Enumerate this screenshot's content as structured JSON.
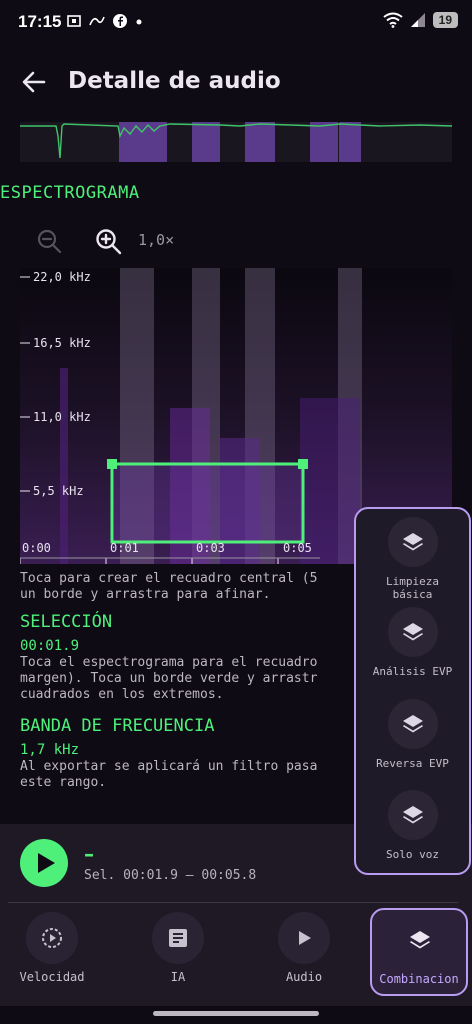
{
  "status_bar": {
    "time": "17:15",
    "battery": "19"
  },
  "app_bar": {
    "title": "Detalle de audio"
  },
  "spectrogram": {
    "label": "ESPECTROGRAMA",
    "zoom_level": "1,0×",
    "freq_ticks": [
      "22,0 kHz",
      "16,5 kHz",
      "11,0 kHz",
      "5,5 kHz"
    ],
    "time_ticks": [
      "0:00",
      "0:01",
      "0:03",
      "0:05"
    ],
    "hint_line1": "Toca para crear el recuadro central (5",
    "hint_line2": "un borde y arrastra para afinar."
  },
  "selection": {
    "label": "SELECCIÓN",
    "value": "00:01.9",
    "help_line1": "Toca el espectrograma para el recuadro",
    "help_line2": "margen). Toca un borde verde y arrastr",
    "help_line3": "cuadrados en los extremos."
  },
  "band": {
    "label": "BANDA DE FRECUENCIA",
    "value": "1,7 kHz",
    "help_line1": "Al exportar se aplicará un filtro pasa",
    "help_line2": "este rango."
  },
  "player": {
    "title": "–",
    "range": "Sel. 00:01.9 – 00:05.8"
  },
  "bottom_nav": {
    "items": [
      {
        "label": "Velocidad",
        "icon": "speed-icon"
      },
      {
        "label": "IA",
        "icon": "document-icon"
      },
      {
        "label": "Audio",
        "icon": "play-icon"
      },
      {
        "label": "Combinacion",
        "icon": "layers-icon"
      }
    ]
  },
  "combinations_menu": {
    "items": [
      {
        "label_line1": "Limpieza",
        "label_line2": "básica"
      },
      {
        "label_line1": "Análisis EVP",
        "label_line2": ""
      },
      {
        "label_line1": "Reversa EVP",
        "label_line2": ""
      },
      {
        "label_line1": "Solo voz",
        "label_line2": ""
      }
    ]
  },
  "colors": {
    "accent_green": "#4ef07a",
    "accent_purple": "#b79cf0",
    "background": "#0f0b14"
  }
}
